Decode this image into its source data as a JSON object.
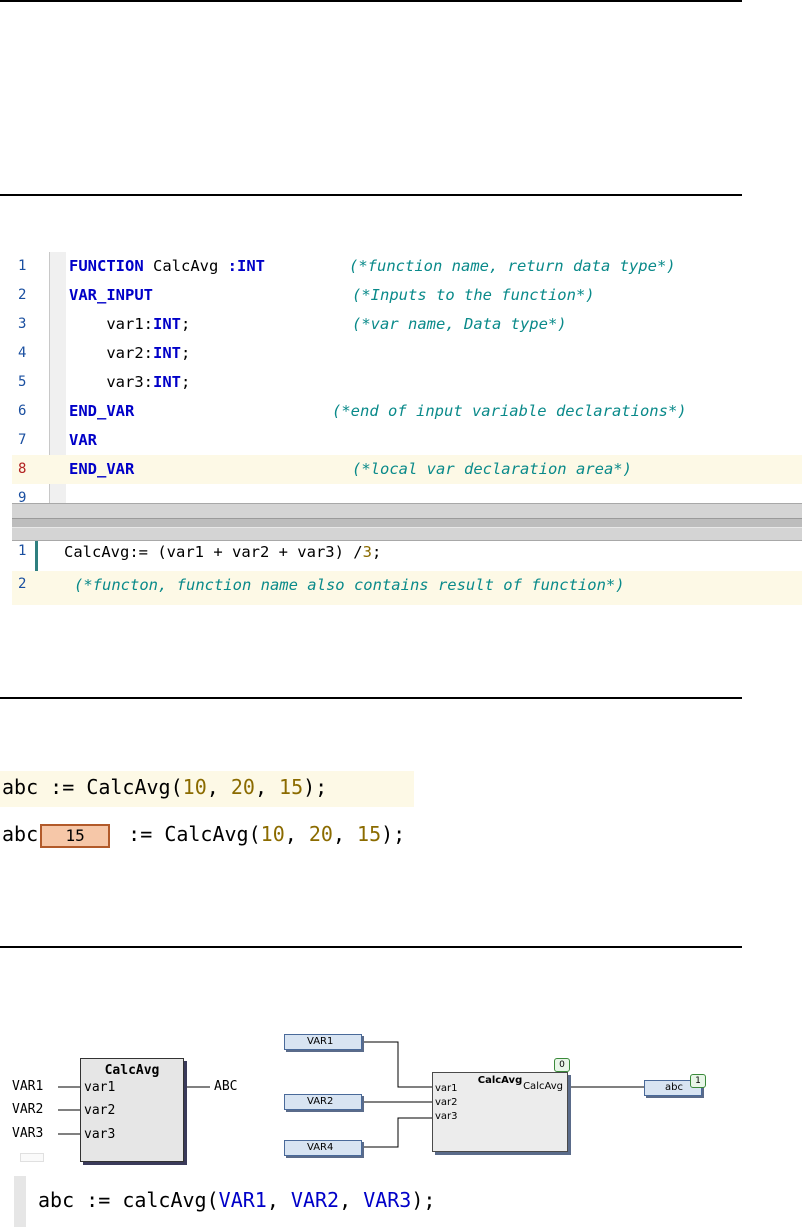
{
  "declaration": {
    "lines": [
      {
        "num": "1",
        "tokens": [
          [
            "kw",
            "FUNCTION"
          ],
          [
            "id",
            " CalcAvg "
          ],
          [
            "kw",
            ":INT"
          ]
        ],
        "comment": "(*function name, return data type*)"
      },
      {
        "num": "2",
        "tokens": [
          [
            "kw",
            "VAR_INPUT"
          ]
        ],
        "comment": "(*Inputs to the function*)"
      },
      {
        "num": "3",
        "tokens": [
          [
            "id",
            "    var1:"
          ],
          [
            "kw",
            "INT"
          ],
          [
            "id",
            ";"
          ]
        ],
        "comment": "(*var name, Data type*)"
      },
      {
        "num": "4",
        "tokens": [
          [
            "id",
            "    var2:"
          ],
          [
            "kw",
            "INT"
          ],
          [
            "id",
            ";"
          ]
        ],
        "comment": ""
      },
      {
        "num": "5",
        "tokens": [
          [
            "id",
            "    var3:"
          ],
          [
            "kw",
            "INT"
          ],
          [
            "id",
            ";"
          ]
        ],
        "comment": ""
      },
      {
        "num": "6",
        "tokens": [
          [
            "kw",
            "END_VAR"
          ]
        ],
        "comment": "(*end of input variable declarations*)"
      },
      {
        "num": "7",
        "tokens": [
          [
            "kw",
            "VAR"
          ]
        ],
        "comment": ""
      },
      {
        "num": "8",
        "tokens": [
          [
            "kw",
            "END_VAR"
          ]
        ],
        "comment": "(*local var declaration area*)"
      },
      {
        "num": "9",
        "tokens": [],
        "comment": ""
      }
    ]
  },
  "implementation": {
    "line1": {
      "num": "1",
      "name": "CalcAvg",
      "op": ":=",
      "expr": " (var1 + var2 + var3) /",
      "divisor": "3",
      "end": ";"
    },
    "line2": {
      "num": "2",
      "comment": "(*functon, function name also contains result of function*)"
    }
  },
  "calls": {
    "call1": {
      "target": "abc",
      "op": ":=",
      "func": "CalcAvg",
      "args": [
        "10",
        "20",
        "15"
      ]
    },
    "call2": {
      "target": "abc",
      "monitor_value": "15",
      "op": ":=",
      "func": "CalcAvg",
      "args": [
        "10",
        "20",
        "15"
      ]
    }
  },
  "fbd_left": {
    "title": "CalcAvg",
    "inputs": [
      "var1",
      "var2",
      "var3"
    ],
    "input_vars": [
      "VAR1",
      "VAR2",
      "VAR3"
    ],
    "output_var": "ABC"
  },
  "fbd_right": {
    "title": "CalcAvg",
    "inputs": [
      "var1",
      "var2",
      "var3"
    ],
    "output_pin": "CalcAvg",
    "input_vars": [
      "VAR1",
      "VAR2",
      "VAR4"
    ],
    "output_var": "abc",
    "block_order": "0",
    "output_order": "1"
  },
  "final_call": {
    "target": "abc",
    "op": ":=",
    "func": "calcAvg",
    "args": [
      "VAR1",
      "VAR2",
      "VAR3"
    ]
  },
  "colors": {
    "keyword": "#0000c8",
    "comment": "#0a8a8a",
    "number": "#8b6b00",
    "highlight": "#fdf9e6",
    "monitor": "#f6c7a8"
  }
}
